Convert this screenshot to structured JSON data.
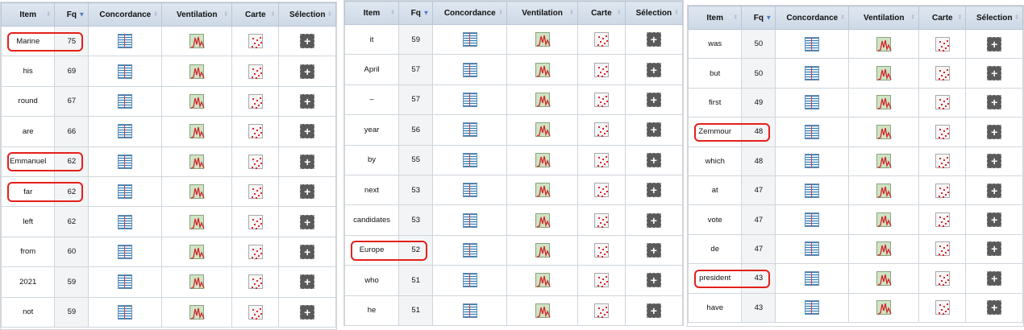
{
  "headers": {
    "item": "Item",
    "fq": "Fq",
    "concordance": "Concordance",
    "ventilation": "Ventilation",
    "carte": "Carte",
    "selection": "Sélection"
  },
  "sort": {
    "column": "Fq",
    "direction": "descending"
  },
  "icons": {
    "concordance": "concordance-icon",
    "ventilation": "ventilation-chart-icon",
    "carte": "map-icon",
    "selection": "add-selection-icon"
  },
  "highlight_color": "#e3201b",
  "tables": [
    {
      "rows": [
        {
          "item": "Marine",
          "fq": "75",
          "highlighted": true
        },
        {
          "item": "his",
          "fq": "69",
          "highlighted": false
        },
        {
          "item": "round",
          "fq": "67",
          "highlighted": false
        },
        {
          "item": "are",
          "fq": "66",
          "highlighted": false
        },
        {
          "item": "Emmanuel",
          "fq": "62",
          "highlighted": true
        },
        {
          "item": "far",
          "fq": "62",
          "highlighted": true
        },
        {
          "item": "left",
          "fq": "62",
          "highlighted": false
        },
        {
          "item": "from",
          "fq": "60",
          "highlighted": false
        },
        {
          "item": "2021",
          "fq": "59",
          "highlighted": false
        },
        {
          "item": "not",
          "fq": "59",
          "highlighted": false
        }
      ]
    },
    {
      "rows": [
        {
          "item": "it",
          "fq": "59",
          "highlighted": false
        },
        {
          "item": "April",
          "fq": "57",
          "highlighted": false
        },
        {
          "item": "–",
          "fq": "57",
          "highlighted": false
        },
        {
          "item": "year",
          "fq": "56",
          "highlighted": false
        },
        {
          "item": "by",
          "fq": "55",
          "highlighted": false
        },
        {
          "item": "next",
          "fq": "53",
          "highlighted": false
        },
        {
          "item": "candidates",
          "fq": "53",
          "highlighted": false
        },
        {
          "item": "Europe",
          "fq": "52",
          "highlighted": true
        },
        {
          "item": "who",
          "fq": "51",
          "highlighted": false
        },
        {
          "item": "he",
          "fq": "51",
          "highlighted": false
        }
      ]
    },
    {
      "rows": [
        {
          "item": "was",
          "fq": "50",
          "highlighted": false
        },
        {
          "item": "but",
          "fq": "50",
          "highlighted": false
        },
        {
          "item": "first",
          "fq": "49",
          "highlighted": false
        },
        {
          "item": "Zemmour",
          "fq": "48",
          "highlighted": true
        },
        {
          "item": "which",
          "fq": "48",
          "highlighted": false
        },
        {
          "item": "at",
          "fq": "47",
          "highlighted": false
        },
        {
          "item": "vote",
          "fq": "47",
          "highlighted": false
        },
        {
          "item": "de",
          "fq": "47",
          "highlighted": false
        },
        {
          "item": "president",
          "fq": "43",
          "highlighted": true
        },
        {
          "item": "have",
          "fq": "43",
          "highlighted": false
        }
      ]
    }
  ]
}
